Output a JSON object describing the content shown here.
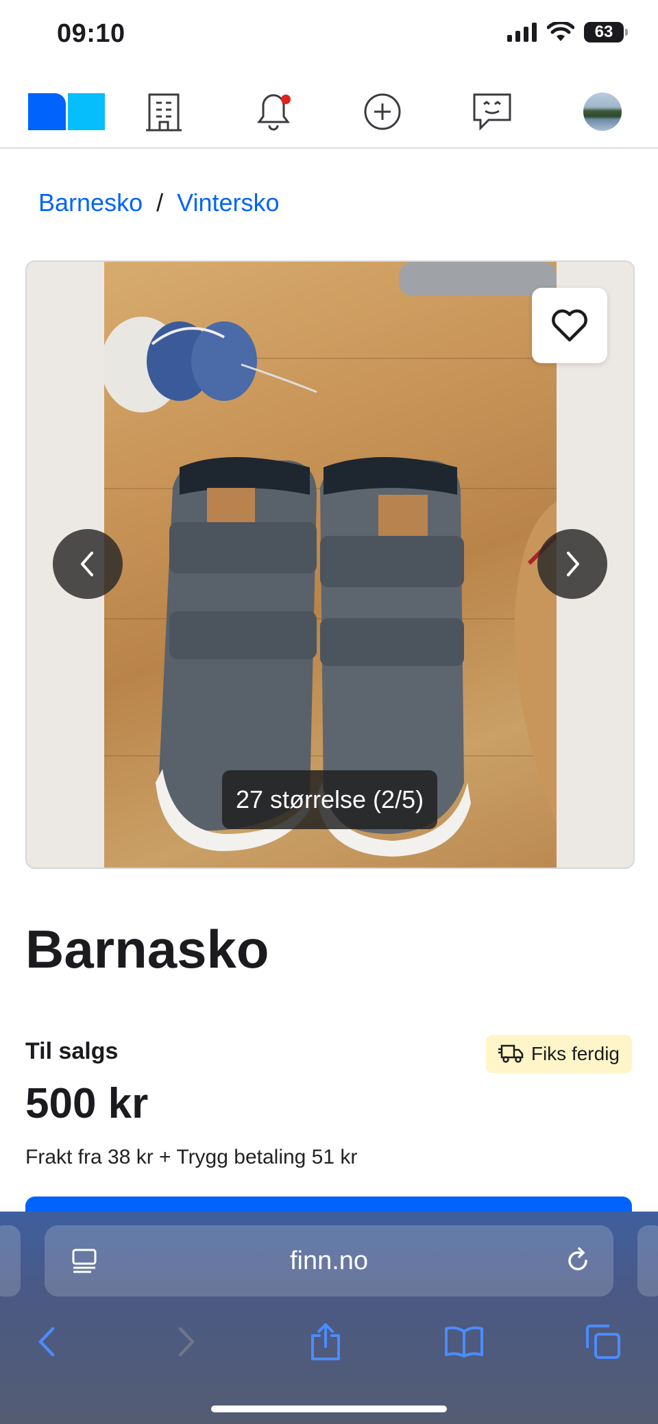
{
  "status_bar": {
    "time": "09:10",
    "battery": "63"
  },
  "nav": {
    "items": [
      {
        "icon": "finn-logo"
      },
      {
        "icon": "building-icon"
      },
      {
        "icon": "bell-icon",
        "has_notification": true
      },
      {
        "icon": "plus-circle-icon"
      },
      {
        "icon": "chat-icon"
      },
      {
        "icon": "avatar"
      }
    ]
  },
  "breadcrumb": {
    "items": [
      "Barnesko",
      "Vintersko"
    ],
    "separator": "/"
  },
  "gallery": {
    "caption": "27 størrelse (2/5)",
    "current": 2,
    "total": 5
  },
  "ad": {
    "title": "Barnasko",
    "sale_type": "Til salgs",
    "badge": "Fiks ferdig",
    "price": "500 kr",
    "shipping": "Frakt fra 38 kr + Trygg betaling 51 kr"
  },
  "browser": {
    "url": "finn.no"
  },
  "colors": {
    "accent": "#0063fb",
    "badge_bg": "#fff5c8",
    "notification": "#e2231a"
  }
}
